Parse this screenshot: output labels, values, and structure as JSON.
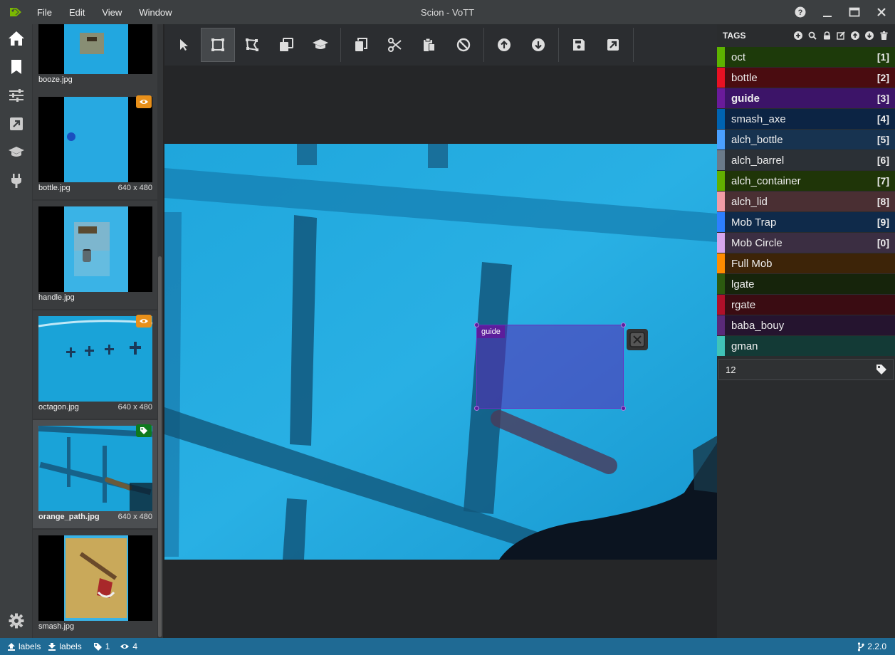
{
  "window": {
    "title": "Scion - VoTT"
  },
  "menu": [
    "File",
    "Edit",
    "View",
    "Window"
  ],
  "filmstrip": {
    "assets": [
      {
        "name": "booze.jpg",
        "dims": "",
        "badge": "",
        "selected": false
      },
      {
        "name": "bottle.jpg",
        "dims": "640 x 480",
        "badge": "visited",
        "selected": false
      },
      {
        "name": "handle.jpg",
        "dims": "",
        "badge": "",
        "selected": false
      },
      {
        "name": "octagon.jpg",
        "dims": "640 x 480",
        "badge": "visited",
        "selected": false
      },
      {
        "name": "orange_path.jpg",
        "dims": "640 x 480",
        "badge": "tagged",
        "selected": true
      },
      {
        "name": "smash.jpg",
        "dims": "",
        "badge": "",
        "selected": false
      }
    ]
  },
  "editor": {
    "region_label": "guide",
    "region_color": "#5c1e9c"
  },
  "tags": {
    "title": "TAGS",
    "items": [
      {
        "name": "oct",
        "key": "[1]",
        "color": "#5db300",
        "bg": "#1d3a0a",
        "selected": false
      },
      {
        "name": "bottle",
        "key": "[2]",
        "color": "#e81123",
        "bg": "#4a0c10",
        "selected": false
      },
      {
        "name": "guide",
        "key": "[3]",
        "color": "#6a1b9a",
        "bg": "#3c1468",
        "selected": true
      },
      {
        "name": "smash_axe",
        "key": "[4]",
        "color": "#0063b1",
        "bg": "#0c2444",
        "selected": false
      },
      {
        "name": "alch_bottle",
        "key": "[5]",
        "color": "#4aa0ff",
        "bg": "#173350",
        "selected": false
      },
      {
        "name": "alch_barrel",
        "key": "[6]",
        "color": "#6b7b8a",
        "bg": "#2b3036",
        "selected": false
      },
      {
        "name": "alch_container",
        "key": "[7]",
        "color": "#62b000",
        "bg": "#1f3508",
        "selected": false
      },
      {
        "name": "alch_lid",
        "key": "[8]",
        "color": "#f29ca6",
        "bg": "#4a2f33",
        "selected": false
      },
      {
        "name": "Mob Trap",
        "key": "[9]",
        "color": "#2d7fff",
        "bg": "#0f2a4a",
        "selected": false
      },
      {
        "name": "Mob Circle",
        "key": "[0]",
        "color": "#d7a6ee",
        "bg": "#3b2e42",
        "selected": false
      },
      {
        "name": "Full Mob",
        "key": "",
        "color": "#ff8c00",
        "bg": "#3d2408",
        "selected": false
      },
      {
        "name": "lgate",
        "key": "",
        "color": "#2c5a0f",
        "bg": "#16240b",
        "selected": false
      },
      {
        "name": "rgate",
        "key": "",
        "color": "#b0102a",
        "bg": "#3a0c12",
        "selected": false
      },
      {
        "name": "baba_bouy",
        "key": "",
        "color": "#5a2a7a",
        "bg": "#25142f",
        "selected": false
      },
      {
        "name": "gman",
        "key": "",
        "color": "#40c4b8",
        "bg": "#133a36",
        "selected": false
      }
    ],
    "input_value": "12"
  },
  "status": {
    "export_label": "labels",
    "import_label": "labels",
    "tagged_count": "1",
    "visited_count": "4",
    "version": "2.2.0"
  }
}
